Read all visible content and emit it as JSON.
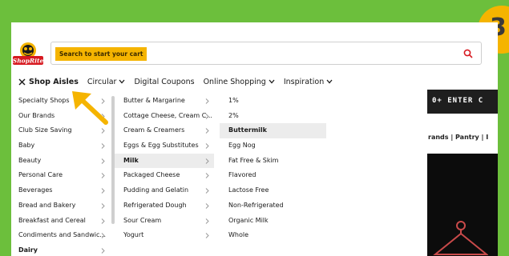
{
  "step_number": "3",
  "brand": {
    "logo_text": "ShopRite",
    "colors": {
      "red": "#d71920",
      "yellow": "#f5b400",
      "green": "#6cbf3c"
    }
  },
  "search": {
    "placeholder": "Search to start your cart"
  },
  "nav": {
    "items": [
      {
        "label": "Shop Aisles",
        "active": true
      },
      {
        "label": "Circular"
      },
      {
        "label": "Digital Coupons"
      },
      {
        "label": "Online Shopping"
      },
      {
        "label": "Inspiration"
      }
    ]
  },
  "aisles": [
    "Specialty Shops",
    "Our Brands",
    "Club Size Saving",
    "Baby",
    "Beauty",
    "Personal Care",
    "Beverages",
    "Bread and Bakery",
    "Breakfast and Cereal",
    "Condiments and Sandwic...",
    "Dairy"
  ],
  "dairy": [
    "Butter & Margarine",
    "Cottage Cheese, Cream C...",
    "Cream & Creamers",
    "Eggs & Egg Substitutes",
    "Milk",
    "Packaged Cheese",
    "Pudding and Gelatin",
    "Refrigerated Dough",
    "Sour Cream",
    "Yogurt"
  ],
  "milk": [
    "1%",
    "2%",
    "Buttermilk",
    "Egg Nog",
    "Fat Free & Skim",
    "Flavored",
    "Lactose Free",
    "Non-Refrigerated",
    "Organic Milk",
    "Whole"
  ],
  "promo": {
    "banner": "0+ ENTER C",
    "links": "rands | Pantry | I"
  }
}
